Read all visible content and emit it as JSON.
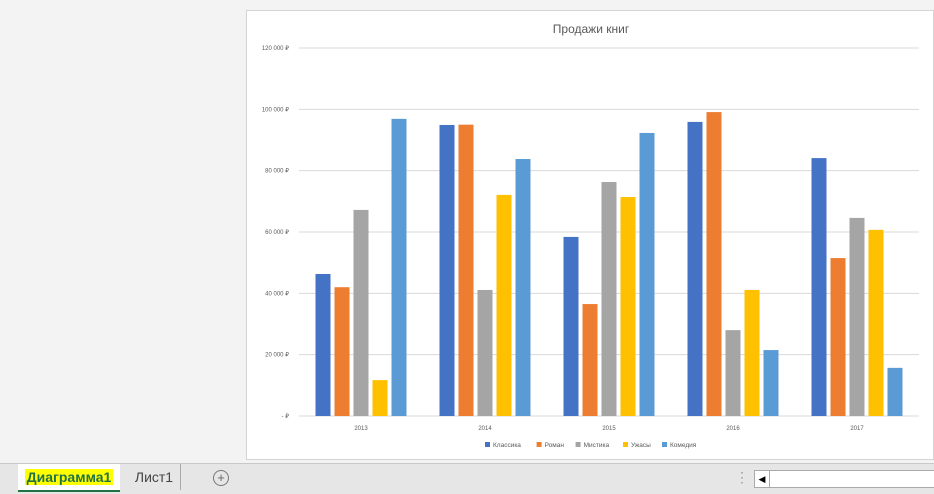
{
  "chart_data": {
    "type": "bar",
    "title": "Продажи книг",
    "categories": [
      "2013",
      "2014",
      "2015",
      "2016",
      "2017"
    ],
    "series": [
      {
        "name": "Классика",
        "color": "#4472c4",
        "values": [
          46300,
          94900,
          58400,
          95900,
          84100
        ]
      },
      {
        "name": "Роман",
        "color": "#ed7d31",
        "values": [
          42000,
          95000,
          36500,
          99100,
          51500
        ]
      },
      {
        "name": "Мистика",
        "color": "#a5a5a5",
        "values": [
          67200,
          41100,
          76300,
          28000,
          64600
        ]
      },
      {
        "name": "Ужасы",
        "color": "#ffc000",
        "values": [
          11700,
          72100,
          71400,
          41100,
          60700
        ]
      },
      {
        "name": "Комедия",
        "color": "#5b9bd5",
        "values": [
          96900,
          83800,
          92300,
          21500,
          15700
        ]
      }
    ],
    "yticks": [
      "-   ₽",
      "20 000 ₽",
      "40 000 ₽",
      "60 000 ₽",
      "80 000 ₽",
      "100 000 ₽",
      "120 000 ₽"
    ],
    "ylim": [
      0,
      120000
    ],
    "grid": true,
    "legend": "bottom"
  },
  "sheets": {
    "tab1": "Диаграмма1",
    "tab2": "Лист1",
    "add": "+"
  },
  "hscroll": {
    "left_arrow": "◀"
  }
}
